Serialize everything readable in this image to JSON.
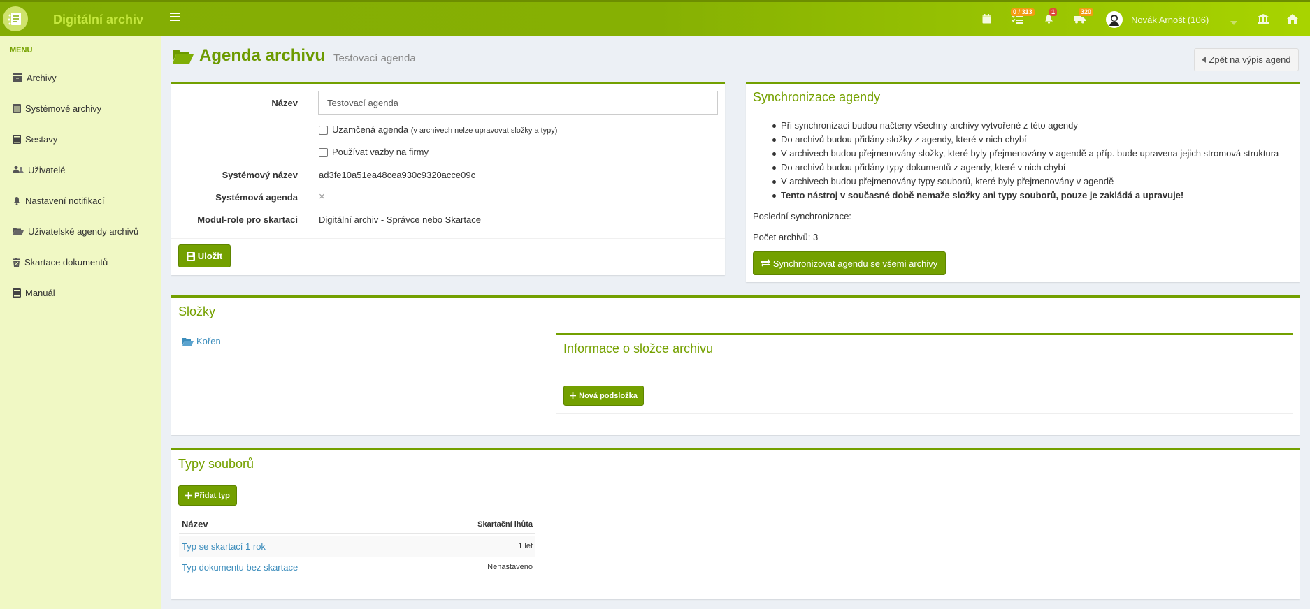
{
  "app": {
    "title": "Digitální archiv"
  },
  "topbar": {
    "badges": {
      "tasks": "0 / 313",
      "notifications": "1",
      "transfers": "320"
    },
    "user_name": "Novák Arnošt (106)"
  },
  "sidebar": {
    "header": "MENU",
    "items": [
      {
        "label": "Archivy"
      },
      {
        "label": "Systémové archivy"
      },
      {
        "label": "Sestavy"
      },
      {
        "label": "Uživatelé"
      },
      {
        "label": "Nastavení notifikací"
      },
      {
        "label": "Uživatelské agendy archivů"
      },
      {
        "label": "Skartace dokumentů"
      },
      {
        "label": "Manuál"
      }
    ]
  },
  "page": {
    "title": "Agenda archivu",
    "subtitle": "Testovací agenda",
    "back_label": "Zpět na výpis agend"
  },
  "form": {
    "name_label": "Název",
    "name_value": "Testovací agenda",
    "locked_label": "Uzamčená agenda",
    "locked_note": "(v archivech nelze upravovat složky a typy)",
    "companies_label": "Používat vazby na firmy",
    "system_name_label": "Systémový název",
    "system_name_value": "ad3fe10a51ea48cea930c9320acce09c",
    "system_agenda_label": "Systémová agenda",
    "system_agenda_value": "×",
    "module_role_label": "Modul-role pro skartaci",
    "module_role_value": "Digitální archiv - Správce nebo Skartace",
    "save_label": "Uložit"
  },
  "sync": {
    "title": "Synchronizace agendy",
    "items": [
      "Při synchronizaci budou načteny všechny archivy vytvořené z této agendy",
      "Do archivů budou přidány složky z agendy, které v nich chybí",
      "V archivech budou přejmenovány složky, které byly přejmenovány v agendě a příp. bude upravena jejich stromová struktura",
      "Do archivů budou přidány typy dokumentů z agendy, které v nich chybí",
      "V archivech budou přejmenovány typy souborů, které byly přejmenovány v agendě"
    ],
    "warning": "Tento nástroj v současné době nemaže složky ani typy souborů, pouze je zakládá a upravuje!",
    "last_sync": "Poslední synchronizace:",
    "archive_count": "Počet archivů: 3",
    "button_label": "Synchronizovat agendu se všemi archivy"
  },
  "folders": {
    "title": "Složky",
    "root": "Kořen",
    "info_title": "Informace o složce archivu",
    "new_subfolder": "Nová podsložka"
  },
  "file_types": {
    "title": "Typy souborů",
    "add_label": "Přidat typ",
    "col_name": "Název",
    "col_period": "Skartační lhůta",
    "rows": [
      {
        "name": "Typ se skartací 1 rok",
        "period": "1 let"
      },
      {
        "name": "Typ dokumentu bez skartace",
        "period": "Nenastaveno"
      }
    ]
  },
  "colors": {
    "accent": "#73a000",
    "sidebar": "#f0f8c4",
    "topbar": "#86b003",
    "link": "#3c8dbc"
  }
}
